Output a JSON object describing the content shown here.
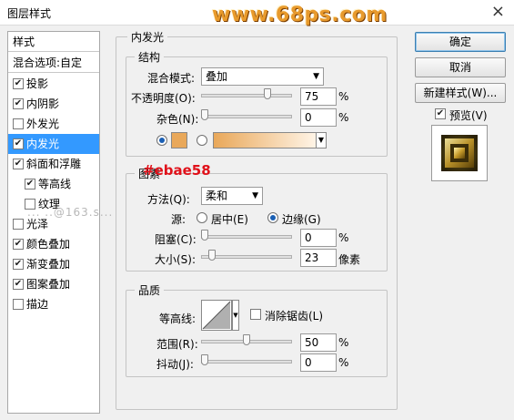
{
  "window": {
    "title": "图层样式",
    "close_glyph": "×"
  },
  "watermark": "www.68ps.com",
  "red_tag": "#ebae58",
  "faint_watermark": "... ..@163.s...",
  "sidebar": {
    "header": "样式",
    "blend_options": "混合选项:自定",
    "items": [
      {
        "label": "投影",
        "checked": true
      },
      {
        "label": "内阴影",
        "checked": true
      },
      {
        "label": "外发光",
        "checked": false
      },
      {
        "label": "内发光",
        "checked": true,
        "selected": true
      },
      {
        "label": "斜面和浮雕",
        "checked": true
      },
      {
        "label": "等高线",
        "checked": true
      },
      {
        "label": "纹理",
        "checked": false
      },
      {
        "label": "光泽",
        "checked": false
      },
      {
        "label": "颜色叠加",
        "checked": true
      },
      {
        "label": "渐变叠加",
        "checked": true
      },
      {
        "label": "图案叠加",
        "checked": true
      },
      {
        "label": "描边",
        "checked": false
      }
    ]
  },
  "panel": {
    "title": "内发光",
    "structure": {
      "title": "结构",
      "blend_mode_label": "混合模式:",
      "blend_mode_value": "叠加",
      "opacity_label": "不透明度(O):",
      "opacity_value": "75",
      "opacity_pct": 0.75,
      "noise_label": "杂色(N):",
      "noise_value": "0",
      "noise_pct": 0.0,
      "unit_pct": "%",
      "solid_color": "#e9a85a",
      "gradient_from": "#e9a85a",
      "gradient_to": "#fff4e6"
    },
    "elements": {
      "title": "图素",
      "technique_label": "方法(Q):",
      "technique_value": "柔和",
      "source_label": "源:",
      "center_label": "居中(E)",
      "edge_label": "边缘(G)",
      "choke_label": "阻塞(C):",
      "choke_value": "0",
      "choke_pct": 0.0,
      "size_label": "大小(S):",
      "size_value": "23",
      "size_pct": 0.09,
      "unit_px": "像素"
    },
    "quality": {
      "title": "品质",
      "contour_label": "等高线:",
      "antialias_label": "消除锯齿(L)",
      "range_label": "范围(R):",
      "range_value": "50",
      "range_pct": 0.5,
      "jitter_label": "抖动(J):",
      "jitter_value": "0",
      "jitter_pct": 0.0
    }
  },
  "buttons": {
    "ok": "确定",
    "cancel": "取消",
    "new_style": "新建样式(W)...",
    "preview_label": "预览(V)",
    "preview_checked": true
  }
}
